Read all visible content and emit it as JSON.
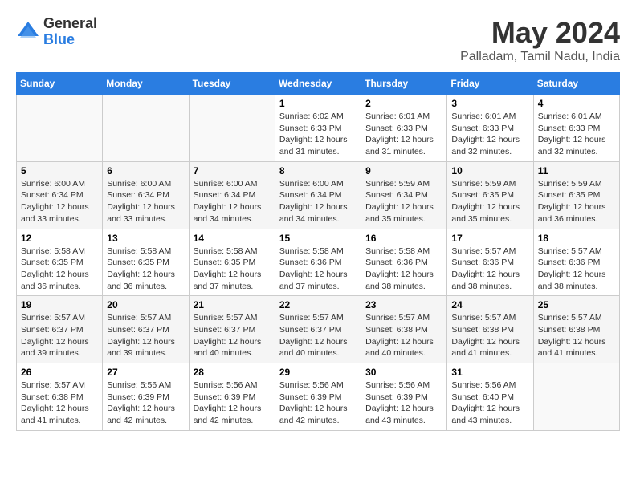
{
  "logo": {
    "general": "General",
    "blue": "Blue"
  },
  "title": "May 2024",
  "location": "Palladam, Tamil Nadu, India",
  "days_of_week": [
    "Sunday",
    "Monday",
    "Tuesday",
    "Wednesday",
    "Thursday",
    "Friday",
    "Saturday"
  ],
  "weeks": [
    [
      {
        "day": "",
        "info": ""
      },
      {
        "day": "",
        "info": ""
      },
      {
        "day": "",
        "info": ""
      },
      {
        "day": "1",
        "info": "Sunrise: 6:02 AM\nSunset: 6:33 PM\nDaylight: 12 hours and 31 minutes."
      },
      {
        "day": "2",
        "info": "Sunrise: 6:01 AM\nSunset: 6:33 PM\nDaylight: 12 hours and 31 minutes."
      },
      {
        "day": "3",
        "info": "Sunrise: 6:01 AM\nSunset: 6:33 PM\nDaylight: 12 hours and 32 minutes."
      },
      {
        "day": "4",
        "info": "Sunrise: 6:01 AM\nSunset: 6:33 PM\nDaylight: 12 hours and 32 minutes."
      }
    ],
    [
      {
        "day": "5",
        "info": "Sunrise: 6:00 AM\nSunset: 6:34 PM\nDaylight: 12 hours and 33 minutes."
      },
      {
        "day": "6",
        "info": "Sunrise: 6:00 AM\nSunset: 6:34 PM\nDaylight: 12 hours and 33 minutes."
      },
      {
        "day": "7",
        "info": "Sunrise: 6:00 AM\nSunset: 6:34 PM\nDaylight: 12 hours and 34 minutes."
      },
      {
        "day": "8",
        "info": "Sunrise: 6:00 AM\nSunset: 6:34 PM\nDaylight: 12 hours and 34 minutes."
      },
      {
        "day": "9",
        "info": "Sunrise: 5:59 AM\nSunset: 6:34 PM\nDaylight: 12 hours and 35 minutes."
      },
      {
        "day": "10",
        "info": "Sunrise: 5:59 AM\nSunset: 6:35 PM\nDaylight: 12 hours and 35 minutes."
      },
      {
        "day": "11",
        "info": "Sunrise: 5:59 AM\nSunset: 6:35 PM\nDaylight: 12 hours and 36 minutes."
      }
    ],
    [
      {
        "day": "12",
        "info": "Sunrise: 5:58 AM\nSunset: 6:35 PM\nDaylight: 12 hours and 36 minutes."
      },
      {
        "day": "13",
        "info": "Sunrise: 5:58 AM\nSunset: 6:35 PM\nDaylight: 12 hours and 36 minutes."
      },
      {
        "day": "14",
        "info": "Sunrise: 5:58 AM\nSunset: 6:35 PM\nDaylight: 12 hours and 37 minutes."
      },
      {
        "day": "15",
        "info": "Sunrise: 5:58 AM\nSunset: 6:36 PM\nDaylight: 12 hours and 37 minutes."
      },
      {
        "day": "16",
        "info": "Sunrise: 5:58 AM\nSunset: 6:36 PM\nDaylight: 12 hours and 38 minutes."
      },
      {
        "day": "17",
        "info": "Sunrise: 5:57 AM\nSunset: 6:36 PM\nDaylight: 12 hours and 38 minutes."
      },
      {
        "day": "18",
        "info": "Sunrise: 5:57 AM\nSunset: 6:36 PM\nDaylight: 12 hours and 38 minutes."
      }
    ],
    [
      {
        "day": "19",
        "info": "Sunrise: 5:57 AM\nSunset: 6:37 PM\nDaylight: 12 hours and 39 minutes."
      },
      {
        "day": "20",
        "info": "Sunrise: 5:57 AM\nSunset: 6:37 PM\nDaylight: 12 hours and 39 minutes."
      },
      {
        "day": "21",
        "info": "Sunrise: 5:57 AM\nSunset: 6:37 PM\nDaylight: 12 hours and 40 minutes."
      },
      {
        "day": "22",
        "info": "Sunrise: 5:57 AM\nSunset: 6:37 PM\nDaylight: 12 hours and 40 minutes."
      },
      {
        "day": "23",
        "info": "Sunrise: 5:57 AM\nSunset: 6:38 PM\nDaylight: 12 hours and 40 minutes."
      },
      {
        "day": "24",
        "info": "Sunrise: 5:57 AM\nSunset: 6:38 PM\nDaylight: 12 hours and 41 minutes."
      },
      {
        "day": "25",
        "info": "Sunrise: 5:57 AM\nSunset: 6:38 PM\nDaylight: 12 hours and 41 minutes."
      }
    ],
    [
      {
        "day": "26",
        "info": "Sunrise: 5:57 AM\nSunset: 6:38 PM\nDaylight: 12 hours and 41 minutes."
      },
      {
        "day": "27",
        "info": "Sunrise: 5:56 AM\nSunset: 6:39 PM\nDaylight: 12 hours and 42 minutes."
      },
      {
        "day": "28",
        "info": "Sunrise: 5:56 AM\nSunset: 6:39 PM\nDaylight: 12 hours and 42 minutes."
      },
      {
        "day": "29",
        "info": "Sunrise: 5:56 AM\nSunset: 6:39 PM\nDaylight: 12 hours and 42 minutes."
      },
      {
        "day": "30",
        "info": "Sunrise: 5:56 AM\nSunset: 6:39 PM\nDaylight: 12 hours and 43 minutes."
      },
      {
        "day": "31",
        "info": "Sunrise: 5:56 AM\nSunset: 6:40 PM\nDaylight: 12 hours and 43 minutes."
      },
      {
        "day": "",
        "info": ""
      }
    ]
  ]
}
